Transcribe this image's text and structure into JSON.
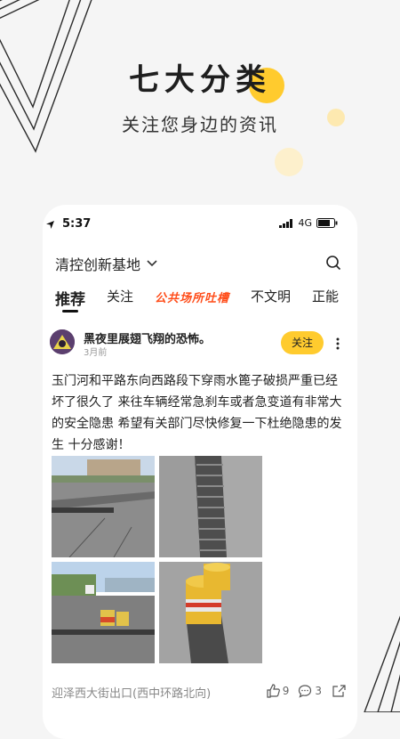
{
  "hero": {
    "title": "七大分类",
    "subtitle": "关注您身边的资讯"
  },
  "status_bar": {
    "time": "5:37",
    "network": "4G"
  },
  "location": {
    "name": "清控创新基地"
  },
  "tabs": [
    {
      "label": "推荐",
      "active": true
    },
    {
      "label": "关注",
      "active": false
    },
    {
      "label": "公共场所吐槽",
      "active": false
    },
    {
      "label": "不文明",
      "active": false
    },
    {
      "label": "正能",
      "active": false
    }
  ],
  "post": {
    "author": "黑夜里展翅飞翔的恐怖。",
    "time": "3月前",
    "follow_label": "关注",
    "content": "玉门河和平路东向西路段下穿雨水篦子破损严重已经坏了很久了 来往车辆经常急刹车或者急变道有非常大的安全隐患 希望有关部门尽快修复一下杜绝隐患的发生 十分感谢！",
    "location": "迎泽西大街出口(西中环路北向)",
    "likes": "9",
    "comments": "3"
  },
  "colors": {
    "accent": "#ffcb2e",
    "special_tab": "#ff4d1a",
    "background": "#f5f5f5"
  }
}
